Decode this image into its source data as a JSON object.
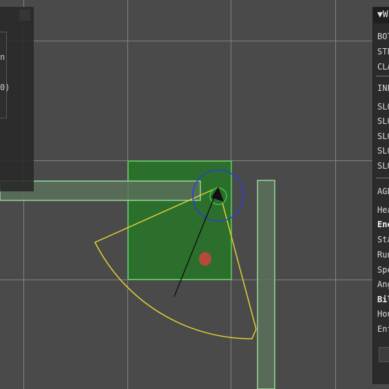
{
  "colors": {
    "background": "#4a4a4a",
    "grid": "#8a8a8a",
    "room_fill": "#2c6e2c",
    "room_border": "#5fd65f",
    "wall_fill": "#5a705a",
    "wall_border": "#9ad79a",
    "vision_cone": "#e6d230",
    "agent_radius": "#2b3fd6",
    "agent_body": "#3fc13f",
    "target": "#b54a3a",
    "heading_line": "#111111"
  },
  "left_panel": {
    "fragments": [
      "n",
      "0)"
    ]
  },
  "right_panel": {
    "title": "▼W",
    "rows": [
      "BOT",
      "STE",
      "CLA",
      "INP",
      "SLO",
      "SLO",
      "SLO",
      "SLO",
      "SLO",
      "AGE",
      "Hea",
      "Ene",
      "Sta",
      "Run",
      "Spe",
      "Ang",
      "Bil",
      "Hou",
      "Ent"
    ]
  }
}
